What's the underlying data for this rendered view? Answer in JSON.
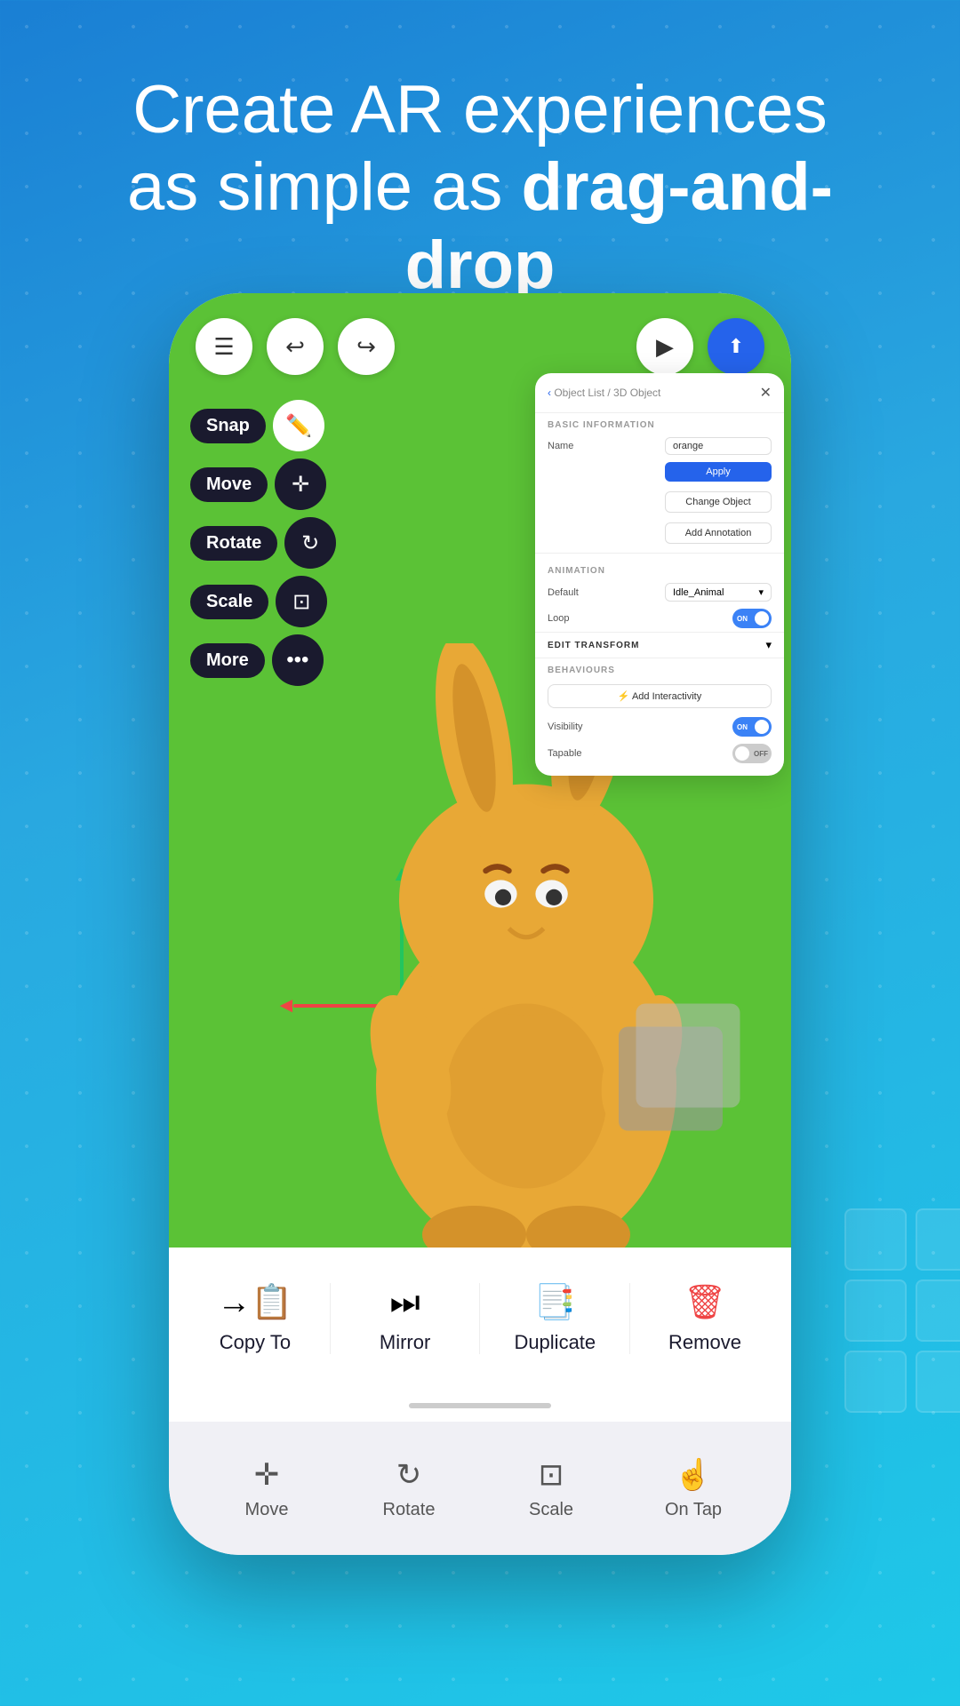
{
  "hero": {
    "line1": "Create AR experiences",
    "line2": "as simple as ",
    "line2_bold": "drag-and-drop"
  },
  "toolbar": {
    "menu_label": "☰",
    "undo_label": "↩",
    "redo_label": "↪",
    "play_label": "▶",
    "share_label": "⬆"
  },
  "left_tools": {
    "snap_label": "Snap",
    "move_label": "Move",
    "rotate_label": "Rotate",
    "scale_label": "Scale",
    "more_label": "More"
  },
  "panel": {
    "breadcrumb": "Object List / 3D Object",
    "close": "✕",
    "basic_info_title": "BASIC INFORMATION",
    "name_label": "Name",
    "name_value": "orange",
    "apply_btn": "Apply",
    "change_object_btn": "Change Object",
    "add_annotation_btn": "Add Annotation",
    "animation_title": "ANIMATION",
    "default_label": "Default",
    "default_value": "Idle_Animal",
    "loop_label": "Loop",
    "edit_transform_title": "EDIT TRANSFORM",
    "behaviours_title": "BEHAVIOURS",
    "add_interactivity_btn": "⚡ Add Interactivity",
    "visibility_label": "Visibility",
    "tapable_label": "Tapable",
    "back_icon": "‹"
  },
  "bottom_actions": {
    "copy_to_label": "Copy To",
    "copy_to_icon": "→📋",
    "mirror_label": "Mirror",
    "mirror_icon": "⏭",
    "duplicate_label": "Duplicate",
    "duplicate_icon": "📑",
    "remove_label": "Remove",
    "remove_icon": "🗑"
  },
  "bottom_tabs": {
    "move_label": "Move",
    "rotate_label": "Rotate",
    "scale_label": "Scale",
    "ontap_label": "On Tap"
  }
}
